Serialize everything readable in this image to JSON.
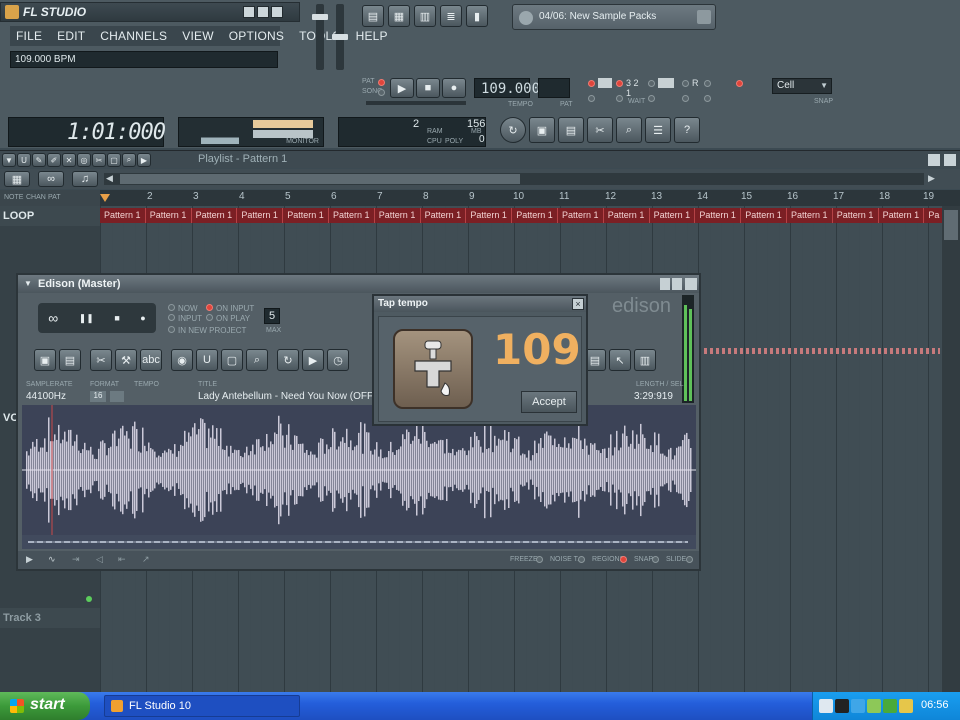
{
  "app": {
    "logo_text": "FL STUDIO",
    "menu": [
      "FILE",
      "EDIT",
      "CHANNELS",
      "VIEW",
      "OPTIONS",
      "TOOLS",
      "HELP"
    ],
    "bpm_hint": "109.000 BPM",
    "sample_browser": "04/06: New Sample Packs",
    "tempo_value": "109.000",
    "tempo_label": "TEMPO",
    "pat_label": "PAT",
    "song_label": "SONG",
    "pat_small": "PAT",
    "song_position": "1:01:000",
    "monitor_label": "MONITOR",
    "cpu_value": "2",
    "poly_value": "156",
    "ram_label": "RAM",
    "cpu_label": "CPU",
    "poly_label": "POLY",
    "mb_label": "MB",
    "zero": "0",
    "snap_value": "Cell",
    "snap_label": "SNAP",
    "wait_label": "WAIT"
  },
  "playlist": {
    "title": "Playlist - Pattern 1",
    "tracks": [
      "LOOP",
      "VO",
      "Track 3"
    ],
    "header_labels": [
      "NOTE",
      "CHAN",
      "PAT"
    ],
    "ruler": [
      "2",
      "3",
      "4",
      "5",
      "6",
      "7",
      "8",
      "9",
      "10",
      "11",
      "12",
      "13",
      "14",
      "15",
      "16",
      "17",
      "18",
      "19"
    ],
    "pattern_label": "Pattern 1",
    "pattern_last": "Pa"
  },
  "edison": {
    "title": "Edison (Master)",
    "now_label": "NOW",
    "input_label": "INPUT",
    "on_input_label": "ON INPUT",
    "on_play_label": "ON PLAY",
    "in_new_project_label": "IN NEW PROJECT",
    "max_value": "5",
    "max_label": "MAX",
    "samplerate_label": "SAMPLERATE",
    "format_label": "FORMAT",
    "tempo_label": "TEMPO",
    "title_label": "TITLE",
    "length_label": "LENGTH / SEL",
    "samplerate": "44100Hz",
    "format_bits": "16",
    "track_title": "Lady Antebellum - Need You Now (OFF",
    "length": "3:29:919",
    "logo": "edison",
    "bottom_labels": [
      "FREEZE",
      "NOISE T.",
      "REGIONS",
      "SNAP",
      "SLIDE"
    ]
  },
  "tap_tempo": {
    "title": "Tap tempo",
    "value": "109",
    "accept_label": "Accept"
  },
  "taskbar": {
    "start_label": "start",
    "window_label": "FL Studio 10",
    "clock": "06:56"
  },
  "colors": {
    "accent_orange": "#f0b060",
    "pattern_red": "#7b1f24",
    "xp_blue": "#245edb",
    "xp_green": "#3c9a3a"
  }
}
